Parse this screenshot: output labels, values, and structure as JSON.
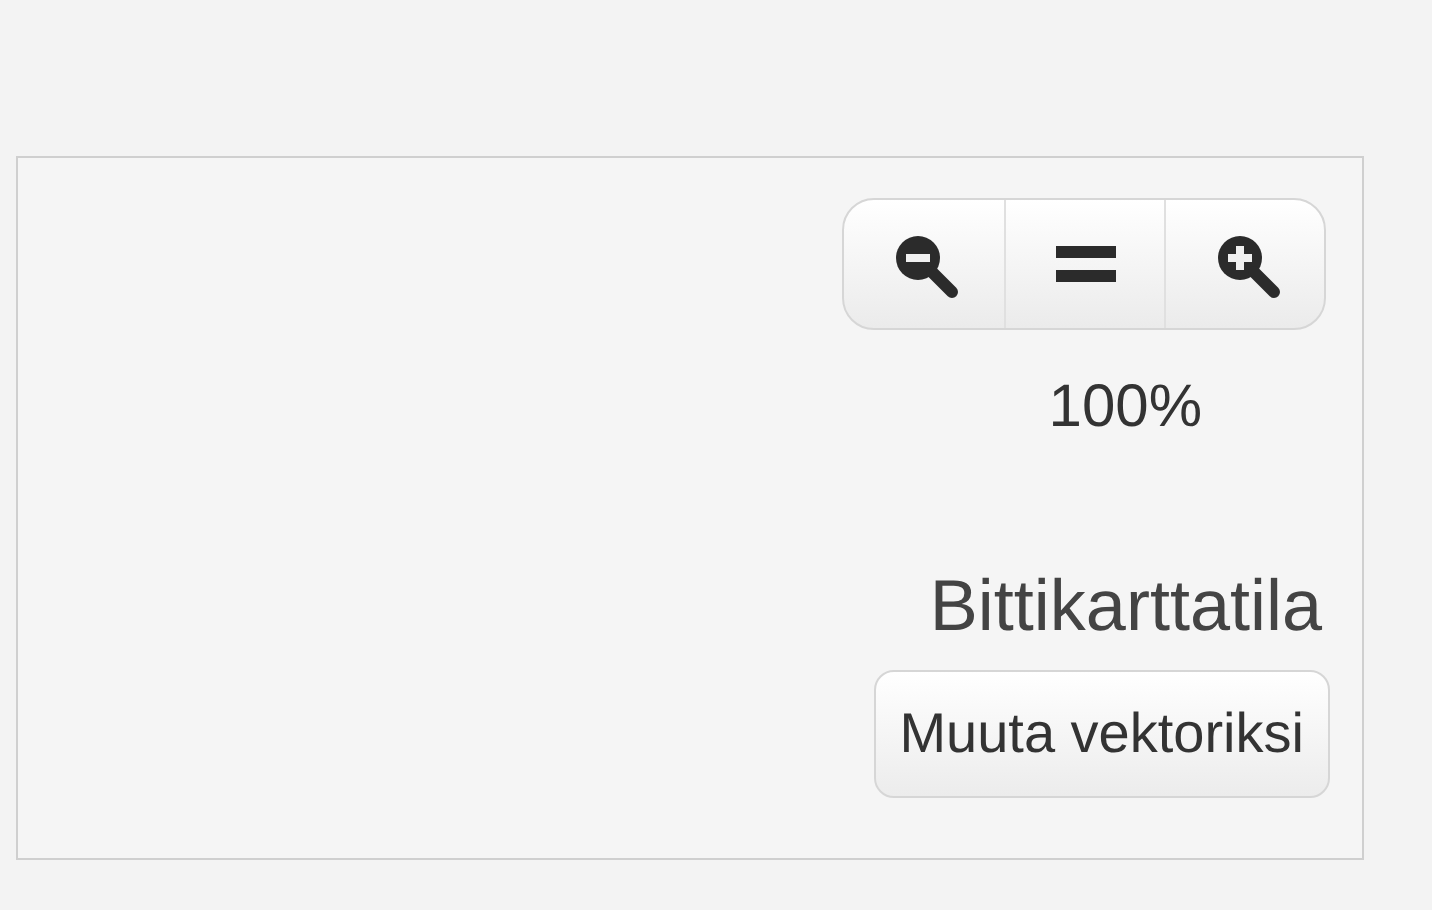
{
  "zoom_controls": {
    "buttons": [
      {
        "kind": "zoom_out"
      },
      {
        "kind": "reset"
      },
      {
        "kind": "zoom_in"
      }
    ],
    "level": "100%"
  },
  "mode_label": "Bittikarttatila",
  "convert_button": {
    "label": "Muuta vektoriksi"
  }
}
